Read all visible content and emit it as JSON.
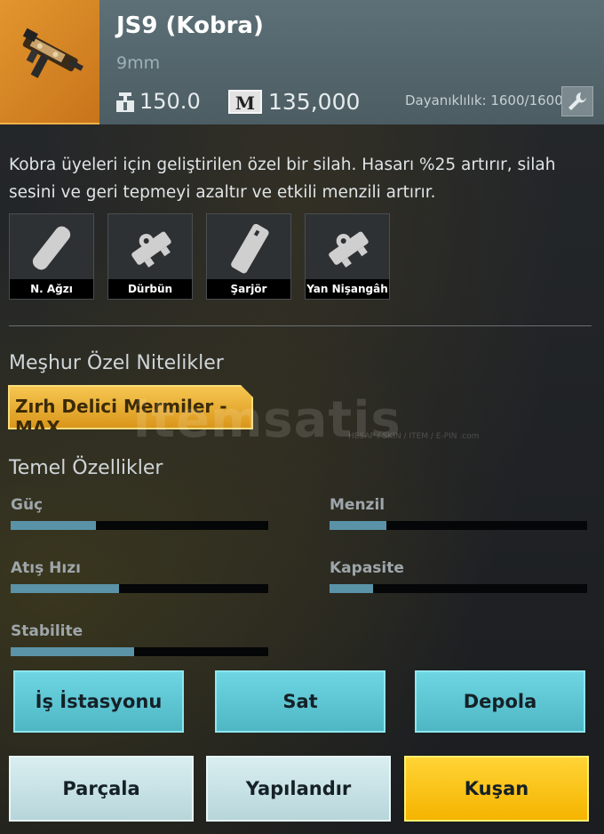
{
  "item": {
    "name": "JS9 (Kobra)",
    "caliber": "9mm",
    "weight": "150.0",
    "price": "135,000",
    "price_icon_letter": "M",
    "durability": "Dayanıklılık: 1600/1600"
  },
  "description": "Kobra üyeleri için geliştirilen özel bir silah. Hasarı %25 artırır, silah sesini ve geri tepmeyi azaltır ve etkili menzili artırır.",
  "attachments": [
    {
      "label": "N. Ağzı",
      "icon": "suppressor-icon"
    },
    {
      "label": "Dürbün",
      "icon": "scope-icon"
    },
    {
      "label": "Şarjör",
      "icon": "magazine-icon"
    },
    {
      "label": "Yan Nişangâh",
      "icon": "scope-icon"
    }
  ],
  "special_traits": {
    "title": "Meşhur Özel Nitelikler",
    "perk": "Zırh Delici Mermiler - MAX"
  },
  "stats": {
    "title": "Temel Özellikler",
    "items": [
      {
        "label": "Güç",
        "value": 0.33
      },
      {
        "label": "Menzil",
        "value": 0.22
      },
      {
        "label": "Atış Hızı",
        "value": 0.42
      },
      {
        "label": "Kapasite",
        "value": 0.17
      },
      {
        "label": "Stabilite",
        "value": 0.48
      }
    ]
  },
  "buttons": {
    "workstation": "İş İstasyonu",
    "sell": "Sat",
    "store": "Depola",
    "dismantle": "Parçala",
    "configure": "Yapılandır",
    "equip": "Kuşan"
  },
  "watermark": {
    "brand": "itemsatis",
    "tagline": "HESAP / SKIN / ITEM / E-PIN",
    "domain": ".com"
  },
  "colors": {
    "header": "#56686f",
    "thumb": "#d8832a",
    "perk": "#f0b431",
    "bar_fill": "#5a93a8",
    "teal_button": "#5ec6d3",
    "equip_button": "#ffc619"
  }
}
